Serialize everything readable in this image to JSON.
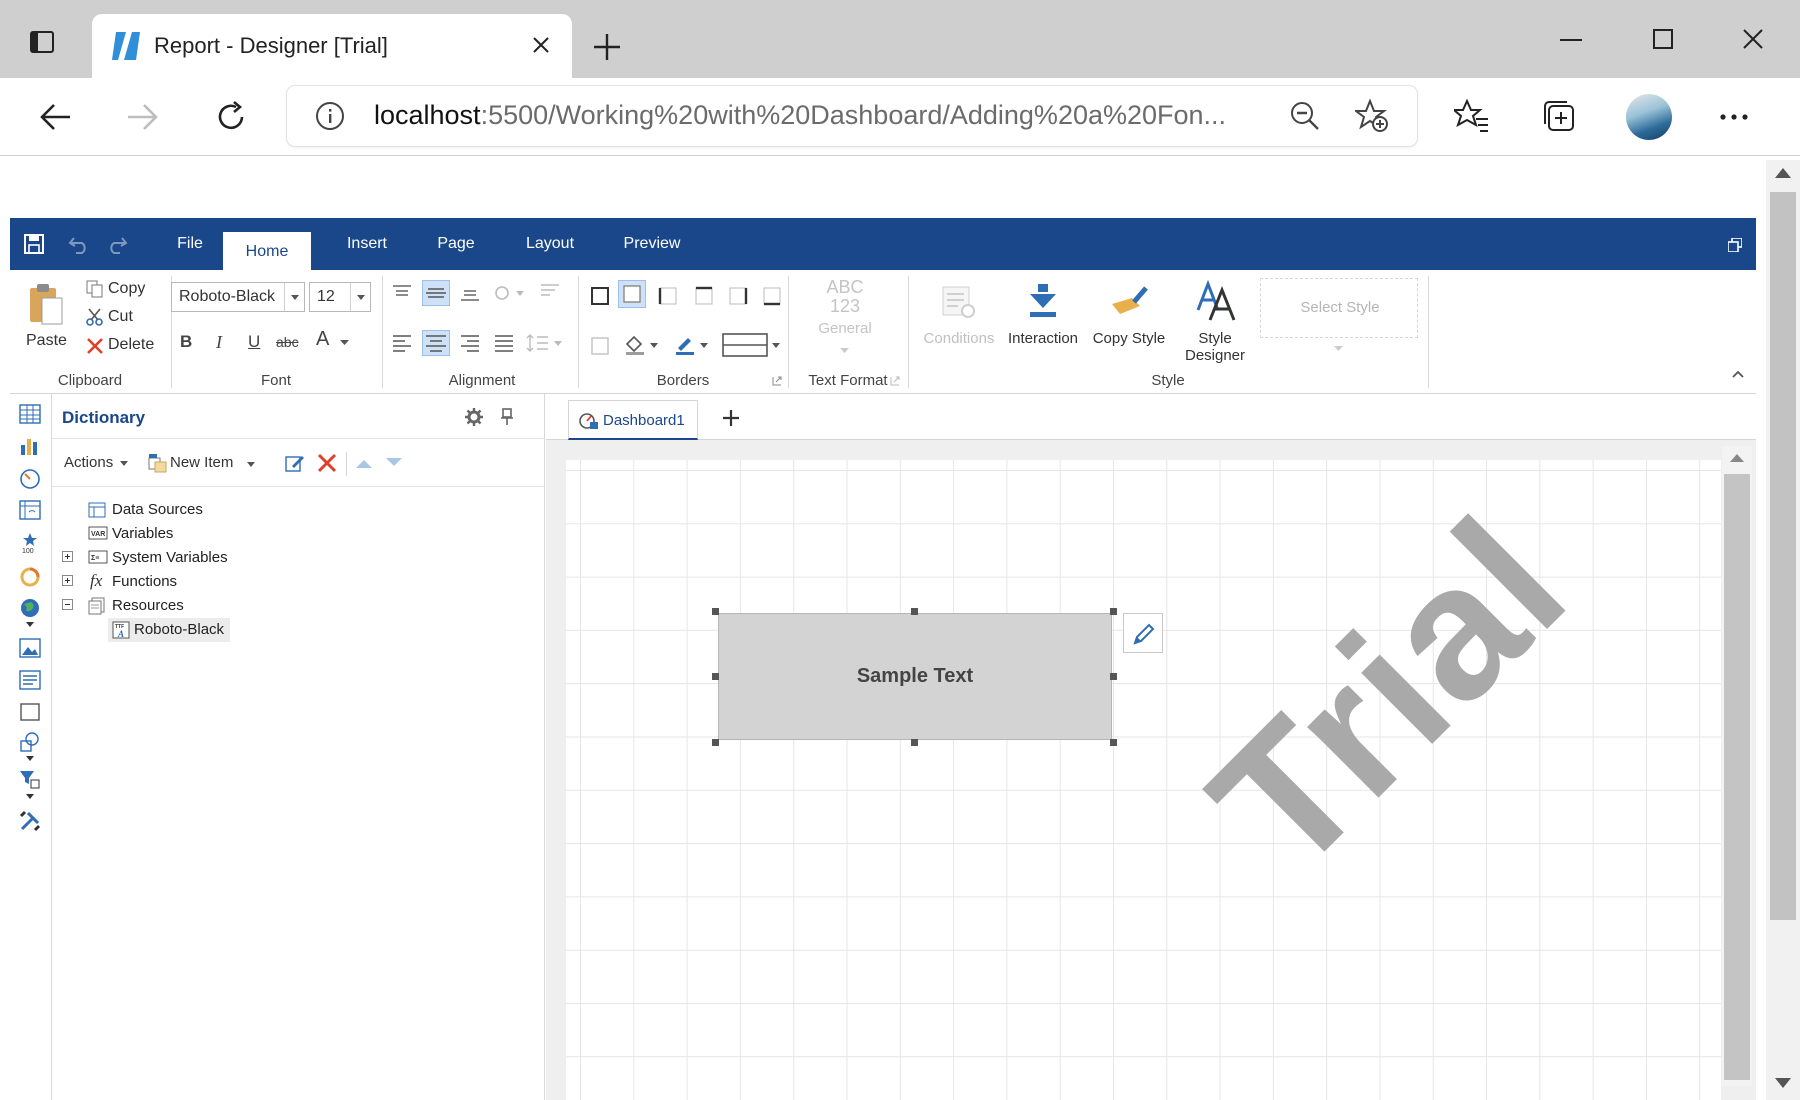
{
  "browser": {
    "tab_title": "Report - Designer [Trial]",
    "url_host": "localhost",
    "url_path": ":5500/Working%20with%20Dashboard/Adding%20a%20Fon..."
  },
  "ribbon": {
    "tabs": [
      {
        "label": "File"
      },
      {
        "label": "Home"
      },
      {
        "label": "Insert"
      },
      {
        "label": "Page"
      },
      {
        "label": "Layout"
      },
      {
        "label": "Preview"
      }
    ],
    "clipboard": {
      "paste": "Paste",
      "copy": "Copy",
      "cut": "Cut",
      "delete": "Delete",
      "group": "Clipboard"
    },
    "font": {
      "name": "Roboto-Black",
      "size": "12",
      "bold": "B",
      "italic": "I",
      "underline": "U",
      "strike": "abc",
      "color": "A",
      "group": "Font"
    },
    "alignment": {
      "group": "Alignment"
    },
    "borders": {
      "group": "Borders"
    },
    "text_format": {
      "abc": "ABC",
      "num": "123",
      "general": "General",
      "group": "Text Format"
    },
    "style": {
      "conditions": "Conditions",
      "interaction": "Interaction",
      "copy_style": "Copy Style",
      "style_designer_1": "Style",
      "style_designer_2": "Designer",
      "select_style": "Select Style",
      "group": "Style"
    }
  },
  "dictionary": {
    "title": "Dictionary",
    "actions": "Actions",
    "new_item": "New Item",
    "tree": [
      {
        "label": "Data Sources"
      },
      {
        "label": "Variables"
      },
      {
        "label": "System Variables"
      },
      {
        "label": "Functions"
      },
      {
        "label": "Resources"
      },
      {
        "label": "Roboto-Black"
      }
    ]
  },
  "document": {
    "tab": "Dashboard1",
    "sample_text": "Sample Text",
    "watermark": "Trial"
  },
  "colors": {
    "ribbon_blue": "#19478a",
    "element_fill": "#d3d3d3",
    "watermark": "#a9a9a9"
  }
}
